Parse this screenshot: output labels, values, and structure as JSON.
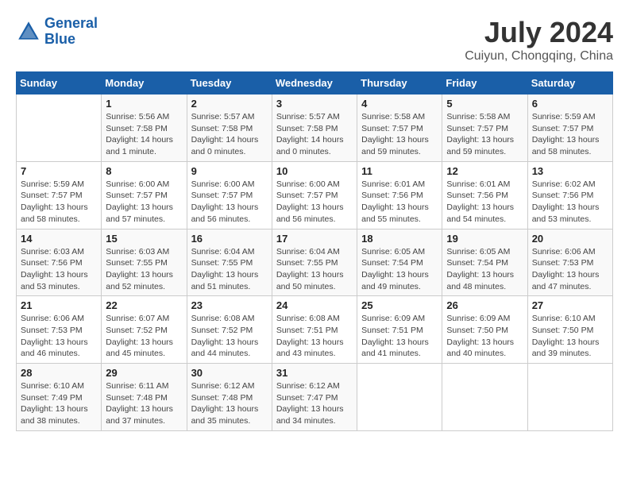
{
  "header": {
    "logo_general": "General",
    "logo_blue": "Blue",
    "title": "July 2024",
    "subtitle": "Cuiyun, Chongqing, China"
  },
  "weekdays": [
    "Sunday",
    "Monday",
    "Tuesday",
    "Wednesday",
    "Thursday",
    "Friday",
    "Saturday"
  ],
  "weeks": [
    [
      {
        "day": "",
        "info": ""
      },
      {
        "day": "1",
        "info": "Sunrise: 5:56 AM\nSunset: 7:58 PM\nDaylight: 14 hours\nand 1 minute."
      },
      {
        "day": "2",
        "info": "Sunrise: 5:57 AM\nSunset: 7:58 PM\nDaylight: 14 hours\nand 0 minutes."
      },
      {
        "day": "3",
        "info": "Sunrise: 5:57 AM\nSunset: 7:58 PM\nDaylight: 14 hours\nand 0 minutes."
      },
      {
        "day": "4",
        "info": "Sunrise: 5:58 AM\nSunset: 7:57 PM\nDaylight: 13 hours\nand 59 minutes."
      },
      {
        "day": "5",
        "info": "Sunrise: 5:58 AM\nSunset: 7:57 PM\nDaylight: 13 hours\nand 59 minutes."
      },
      {
        "day": "6",
        "info": "Sunrise: 5:59 AM\nSunset: 7:57 PM\nDaylight: 13 hours\nand 58 minutes."
      }
    ],
    [
      {
        "day": "7",
        "info": "Sunrise: 5:59 AM\nSunset: 7:57 PM\nDaylight: 13 hours\nand 58 minutes."
      },
      {
        "day": "8",
        "info": "Sunrise: 6:00 AM\nSunset: 7:57 PM\nDaylight: 13 hours\nand 57 minutes."
      },
      {
        "day": "9",
        "info": "Sunrise: 6:00 AM\nSunset: 7:57 PM\nDaylight: 13 hours\nand 56 minutes."
      },
      {
        "day": "10",
        "info": "Sunrise: 6:00 AM\nSunset: 7:57 PM\nDaylight: 13 hours\nand 56 minutes."
      },
      {
        "day": "11",
        "info": "Sunrise: 6:01 AM\nSunset: 7:56 PM\nDaylight: 13 hours\nand 55 minutes."
      },
      {
        "day": "12",
        "info": "Sunrise: 6:01 AM\nSunset: 7:56 PM\nDaylight: 13 hours\nand 54 minutes."
      },
      {
        "day": "13",
        "info": "Sunrise: 6:02 AM\nSunset: 7:56 PM\nDaylight: 13 hours\nand 53 minutes."
      }
    ],
    [
      {
        "day": "14",
        "info": "Sunrise: 6:03 AM\nSunset: 7:56 PM\nDaylight: 13 hours\nand 53 minutes."
      },
      {
        "day": "15",
        "info": "Sunrise: 6:03 AM\nSunset: 7:55 PM\nDaylight: 13 hours\nand 52 minutes."
      },
      {
        "day": "16",
        "info": "Sunrise: 6:04 AM\nSunset: 7:55 PM\nDaylight: 13 hours\nand 51 minutes."
      },
      {
        "day": "17",
        "info": "Sunrise: 6:04 AM\nSunset: 7:55 PM\nDaylight: 13 hours\nand 50 minutes."
      },
      {
        "day": "18",
        "info": "Sunrise: 6:05 AM\nSunset: 7:54 PM\nDaylight: 13 hours\nand 49 minutes."
      },
      {
        "day": "19",
        "info": "Sunrise: 6:05 AM\nSunset: 7:54 PM\nDaylight: 13 hours\nand 48 minutes."
      },
      {
        "day": "20",
        "info": "Sunrise: 6:06 AM\nSunset: 7:53 PM\nDaylight: 13 hours\nand 47 minutes."
      }
    ],
    [
      {
        "day": "21",
        "info": "Sunrise: 6:06 AM\nSunset: 7:53 PM\nDaylight: 13 hours\nand 46 minutes."
      },
      {
        "day": "22",
        "info": "Sunrise: 6:07 AM\nSunset: 7:52 PM\nDaylight: 13 hours\nand 45 minutes."
      },
      {
        "day": "23",
        "info": "Sunrise: 6:08 AM\nSunset: 7:52 PM\nDaylight: 13 hours\nand 44 minutes."
      },
      {
        "day": "24",
        "info": "Sunrise: 6:08 AM\nSunset: 7:51 PM\nDaylight: 13 hours\nand 43 minutes."
      },
      {
        "day": "25",
        "info": "Sunrise: 6:09 AM\nSunset: 7:51 PM\nDaylight: 13 hours\nand 41 minutes."
      },
      {
        "day": "26",
        "info": "Sunrise: 6:09 AM\nSunset: 7:50 PM\nDaylight: 13 hours\nand 40 minutes."
      },
      {
        "day": "27",
        "info": "Sunrise: 6:10 AM\nSunset: 7:50 PM\nDaylight: 13 hours\nand 39 minutes."
      }
    ],
    [
      {
        "day": "28",
        "info": "Sunrise: 6:10 AM\nSunset: 7:49 PM\nDaylight: 13 hours\nand 38 minutes."
      },
      {
        "day": "29",
        "info": "Sunrise: 6:11 AM\nSunset: 7:48 PM\nDaylight: 13 hours\nand 37 minutes."
      },
      {
        "day": "30",
        "info": "Sunrise: 6:12 AM\nSunset: 7:48 PM\nDaylight: 13 hours\nand 35 minutes."
      },
      {
        "day": "31",
        "info": "Sunrise: 6:12 AM\nSunset: 7:47 PM\nDaylight: 13 hours\nand 34 minutes."
      },
      {
        "day": "",
        "info": ""
      },
      {
        "day": "",
        "info": ""
      },
      {
        "day": "",
        "info": ""
      }
    ]
  ]
}
